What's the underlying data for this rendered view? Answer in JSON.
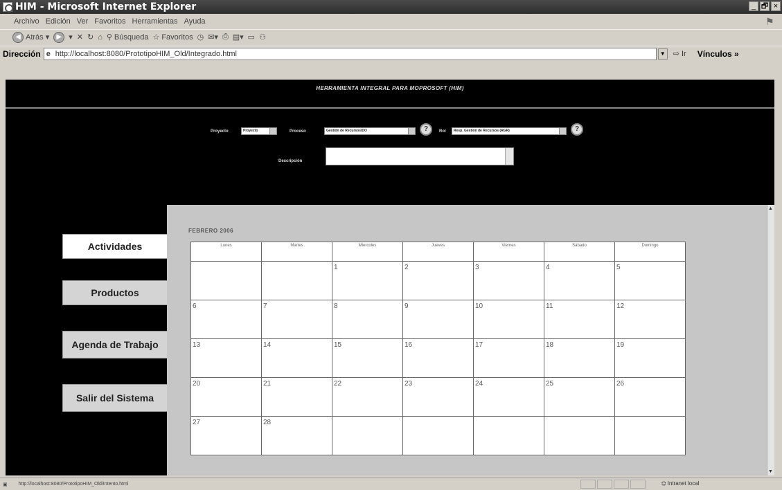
{
  "window": {
    "title": "HIM - Microsoft Internet Explorer",
    "controls": [
      "_",
      "🗗",
      "×"
    ]
  },
  "menu": [
    "Archivo",
    "Edición",
    "Ver",
    "Favoritos",
    "Herramientas",
    "Ayuda"
  ],
  "toolbar": {
    "back": "Atrás",
    "search": "Búsqueda",
    "favorites": "Favoritos"
  },
  "address": {
    "label": "Dirección",
    "url": "http://localhost:8080/PrototipoHIM_Old/Integrado.html",
    "go": "Ir",
    "links": "Vínculos »"
  },
  "page": {
    "header_title": "HERRAMIENTA INTEGRAL PARA MOPROSOFT (HIM)",
    "filters": {
      "proyecto_label": "Proyecto",
      "proyecto_value": "Proyecto",
      "proceso_label": "Proceso",
      "proceso_value": "Gestión de Recursos/DO",
      "rol_label": "Rol",
      "rol_value": "Resp. Gestión de Recursos (RGR)",
      "descripcion_label": "Descripción"
    },
    "nav": [
      {
        "label": "Actividades"
      },
      {
        "label": "Productos"
      },
      {
        "label": "Agenda de Trabajo"
      },
      {
        "label": "Salir del Sistema"
      }
    ],
    "calendar": {
      "month": "FEBRERO 2006",
      "days": [
        "Lunes",
        "Martes",
        "Miercoles",
        "Jueves",
        "Viernes",
        "Sábado",
        "Domingo"
      ],
      "weeks": [
        [
          "",
          "",
          "1",
          "2",
          "3",
          "4",
          "5"
        ],
        [
          "6",
          "7",
          "8",
          "9",
          "10",
          "11",
          "12"
        ],
        [
          "13",
          "14",
          "15",
          "16",
          "17",
          "18",
          "19"
        ],
        [
          "20",
          "21",
          "22",
          "23",
          "24",
          "25",
          "26"
        ],
        [
          "27",
          "28",
          "",
          "",
          "",
          "",
          ""
        ]
      ]
    }
  },
  "status": {
    "text": "http://localhost:8080/PrototipoHIM_Old/Intento.html",
    "zone": "Intranet local"
  }
}
